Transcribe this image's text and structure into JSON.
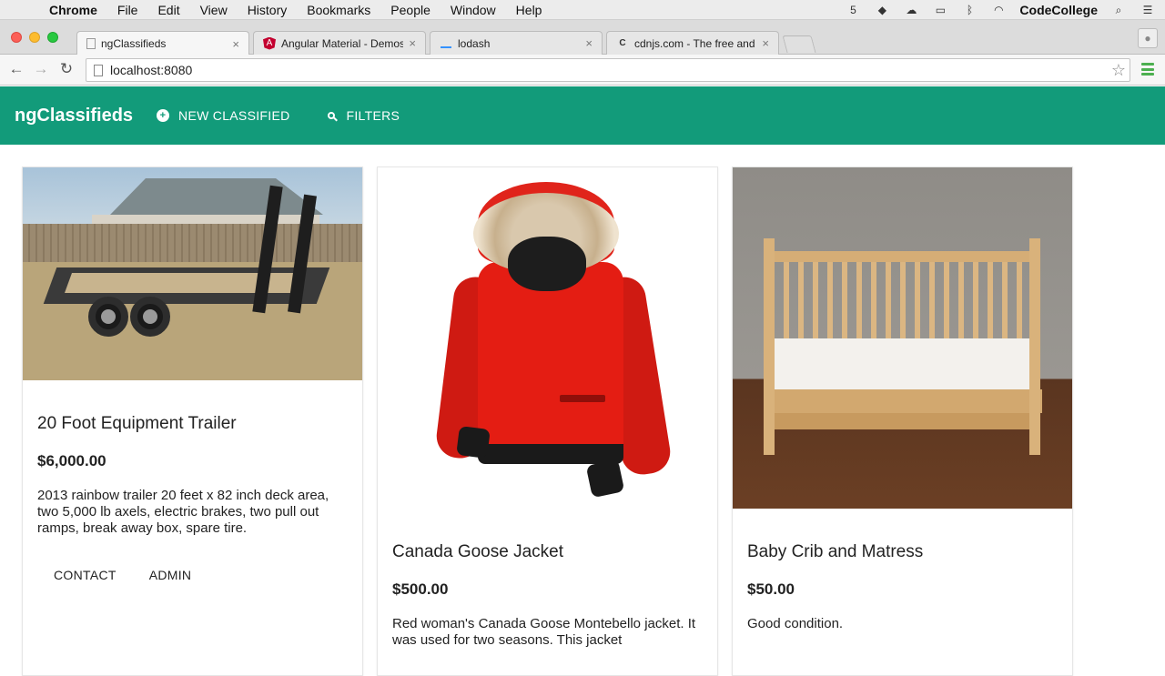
{
  "menubar": {
    "app_name": "Chrome",
    "items": [
      "File",
      "Edit",
      "View",
      "History",
      "Bookmarks",
      "People",
      "Window",
      "Help"
    ],
    "user": "CodeCollege"
  },
  "browser": {
    "tabs": [
      {
        "title": "ngClassifieds",
        "active": true
      },
      {
        "title": "Angular Material - Demos",
        "active": false
      },
      {
        "title": "lodash",
        "active": false
      },
      {
        "title": "cdnjs.com - The free and o",
        "active": false
      }
    ],
    "url": "localhost:8080"
  },
  "app": {
    "title": "ngClassifieds",
    "new_classified_label": "NEW CLASSIFIED",
    "filters_label": "FILTERS",
    "accent_color": "#129b7a"
  },
  "classifieds": [
    {
      "title": "20 Foot Equipment Trailer",
      "price": "$6,000.00",
      "description": "2013 rainbow trailer 20 feet x 82 inch deck area, two 5,000 lb axels, electric brakes, two pull out ramps, break away box, spare tire.",
      "actions": [
        "CONTACT",
        "ADMIN"
      ]
    },
    {
      "title": "Canada Goose Jacket",
      "price": "$500.00",
      "description": "Red woman's Canada Goose Montebello jacket. It was used for two seasons. This jacket"
    },
    {
      "title": "Baby Crib and Matress",
      "price": "$50.00",
      "description": "Good condition."
    }
  ]
}
